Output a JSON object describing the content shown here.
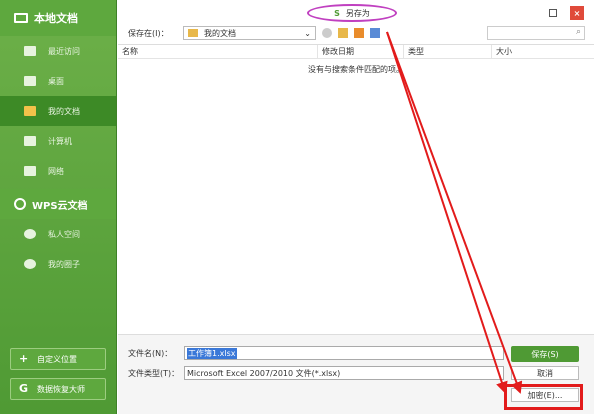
{
  "sidebar": {
    "header_label": "本地文档",
    "items": [
      {
        "label": "最近访问",
        "icon": "recent-icon"
      },
      {
        "label": "桌面",
        "icon": "desktop-icon"
      },
      {
        "label": "我的文档",
        "icon": "folder-icon",
        "active": true
      },
      {
        "label": "计算机",
        "icon": "computer-icon"
      },
      {
        "label": "网络",
        "icon": "network-icon"
      }
    ],
    "cloud_header": "WPS云文档",
    "cloud_items": [
      {
        "label": "私人空间",
        "icon": "user-icon"
      },
      {
        "label": "我的圈子",
        "icon": "group-icon"
      }
    ],
    "custom_location_button": "自定义位置",
    "recovery_button": "数据恢复大师"
  },
  "dialog": {
    "title": "另存为",
    "save_in_label": "保存在(I)：",
    "save_in_value": "我的文档",
    "columns": [
      "名称",
      "修改日期",
      "类型",
      "大小"
    ],
    "empty_message": "没有与搜索条件匹配的项。",
    "filename_label": "文件名(N)：",
    "filename_value": "工作簿1.xlsx",
    "filetype_label": "文件类型(T)：",
    "filetype_value": "Microsoft Excel 2007/2010 文件(*.xlsx)",
    "save_button": "保存(S)",
    "cancel_button": "取消",
    "encrypt_button": "加密(E)..."
  },
  "colors": {
    "sidebar_green": "#5ea83e",
    "active_green": "#3d8a26",
    "highlight_red": "#e21b1b",
    "title_oval_purple": "#c040c0"
  }
}
